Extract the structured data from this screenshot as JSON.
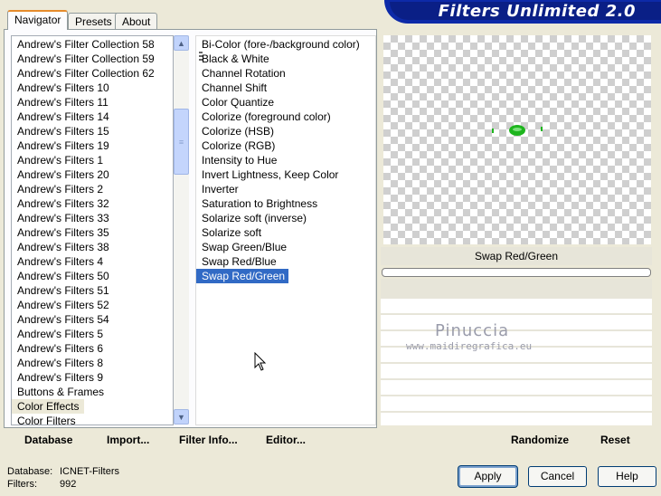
{
  "tabs": [
    "Navigator",
    "Presets",
    "About"
  ],
  "app_title": "Filters Unlimited 2.0",
  "categories": [
    "Andrew's Filter Collection 58",
    "Andrew's Filter Collection 59",
    "Andrew's Filter Collection 62",
    "Andrew's Filters 10",
    "Andrew's Filters 11",
    "Andrew's Filters 14",
    "Andrew's Filters 15",
    "Andrew's Filters 19",
    "Andrew's Filters 1",
    "Andrew's Filters 20",
    "Andrew's Filters 2",
    "Andrew's Filters 32",
    "Andrew's Filters 33",
    "Andrew's Filters 35",
    "Andrew's Filters 38",
    "Andrew's Filters 4",
    "Andrew's Filters 50",
    "Andrew's Filters 51",
    "Andrew's Filters 52",
    "Andrew's Filters 54",
    "Andrew's Filters 5",
    "Andrew's Filters 6",
    "Andrew's Filters 8",
    "Andrew's Filters 9",
    "Buttons & Frames",
    "Color Effects",
    "Color Filters"
  ],
  "selected_category": "Color Effects",
  "filters": [
    "Bi-Color (fore-/background color)",
    "Black & White",
    "Channel Rotation",
    "Channel Shift",
    "Color Quantize",
    "Colorize (foreground color)",
    "Colorize (HSB)",
    "Colorize (RGB)",
    "Intensity to Hue",
    "Invert Lightness, Keep Color",
    "Inverter",
    "Saturation to Brightness",
    "Solarize soft (inverse)",
    "Solarize soft",
    "Swap Green/Blue",
    "Swap Red/Blue",
    "Swap Red/Green"
  ],
  "selected_filter": "Swap Red/Green",
  "preview": {
    "filter_name": "Swap Red/Green"
  },
  "watermark": {
    "name": "Pinuccia",
    "url": "www.maidiregrafica.eu"
  },
  "left_buttons": {
    "database": "Database",
    "import": "Import...",
    "filter_info": "Filter Info...",
    "editor": "Editor..."
  },
  "right_buttons": {
    "randomize": "Randomize",
    "reset": "Reset"
  },
  "status": {
    "database_label": "Database:",
    "database_value": "ICNET-Filters",
    "filters_label": "Filters:",
    "filters_value": "992"
  },
  "dialog_buttons": {
    "apply": "Apply",
    "cancel": "Cancel",
    "help": "Help"
  },
  "colors": {
    "selection": "#316ac5",
    "title_bar": "#0a1f86",
    "preview_object": "#1db51d"
  }
}
